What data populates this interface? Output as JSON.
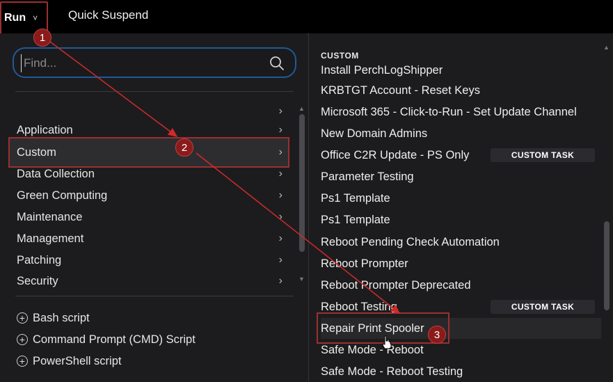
{
  "topbar": {
    "run_label": "Run",
    "run_chevron": "˅",
    "quick_suspend_label": "Quick Suspend"
  },
  "search": {
    "placeholder": "Find...",
    "icon": "search-icon"
  },
  "categories": [
    {
      "label": "",
      "arrow": "›"
    },
    {
      "label": "Application",
      "arrow": "›"
    },
    {
      "label": "Custom",
      "arrow": "›",
      "selected": true
    },
    {
      "label": "Data Collection",
      "arrow": "›"
    },
    {
      "label": "Green Computing",
      "arrow": "›"
    },
    {
      "label": "Maintenance",
      "arrow": "›"
    },
    {
      "label": "Management",
      "arrow": "›"
    },
    {
      "label": "Patching",
      "arrow": "›"
    },
    {
      "label": "Security",
      "arrow": "›"
    }
  ],
  "actions": [
    {
      "label": "Bash script",
      "icon": "plus-circle-icon"
    },
    {
      "label": "Command Prompt (CMD) Script",
      "icon": "plus-circle-icon"
    },
    {
      "label": "PowerShell script",
      "icon": "plus-circle-icon"
    }
  ],
  "task_section": {
    "header": "CUSTOM",
    "tasks": [
      {
        "label": "Install PerchLogShipper"
      },
      {
        "label": "KRBTGT Account - Reset Keys"
      },
      {
        "label": "Microsoft 365 - Click-to-Run - Set Update Channel"
      },
      {
        "label": "New Domain Admins"
      },
      {
        "label": "Office C2R Update - PS Only",
        "badge": "CUSTOM TASK"
      },
      {
        "label": "Parameter Testing"
      },
      {
        "label": "Ps1 Template"
      },
      {
        "label": "Ps1 Template"
      },
      {
        "label": "Reboot Pending Check Automation"
      },
      {
        "label": "Reboot Prompter"
      },
      {
        "label": "Reboot Prompter Deprecated"
      },
      {
        "label": "Reboot Testing",
        "badge": "CUSTOM TASK"
      },
      {
        "label": "Repair Print Spooler",
        "highlighted": true
      },
      {
        "label": "Safe Mode - Reboot"
      },
      {
        "label": "Safe Mode - Reboot Testing"
      }
    ]
  },
  "annotations": [
    {
      "number": "1"
    },
    {
      "number": "2"
    },
    {
      "number": "3"
    }
  ],
  "colors": {
    "background": "#000000",
    "panel": "#1c1c1e",
    "annotation_red": "#9a3030",
    "search_border": "#1f5a9b",
    "badge_bg": "#2b2b2f"
  }
}
